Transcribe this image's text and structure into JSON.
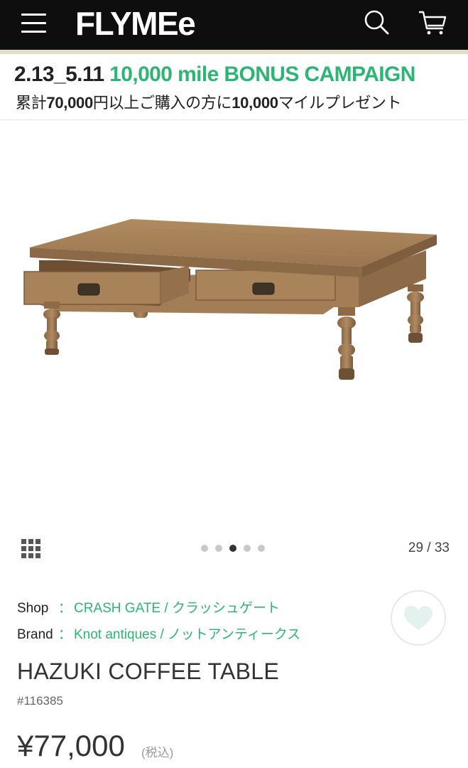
{
  "header": {
    "logo": "FLYMEe",
    "menu_icon": "hamburger-menu-icon",
    "search_icon": "search-icon",
    "cart_icon": "cart-icon",
    "background": "#0e0e0e"
  },
  "banner": {
    "dates": "2.13_5.11",
    "campaign": "10,000 mile BONUS CAMPAIGN",
    "line2_prefix": "累計",
    "line2_amount": "70,000",
    "line2_middle": "円以上ご購入の方に",
    "line2_miles": "10,000",
    "line2_suffix": "マイルプレゼント",
    "accent_color": "#2bb673"
  },
  "gallery": {
    "image": "product-photo-coffee-table",
    "grid_icon": "grid-icon",
    "dots_count": 5,
    "active_dot": 2,
    "counter": "29 / 33"
  },
  "product": {
    "shop_label": "Shop",
    "shop_separator": "：",
    "shop_value": "CRASH GATE / クラッシュゲート",
    "brand_label": "Brand",
    "brand_separator": "：",
    "brand_value": "Knot antiques / ノットアンティークス",
    "title": "HAZUKI COFFEE TABLE",
    "sku": "#116385",
    "price": "¥77,000",
    "tax_note": "(税込)",
    "favorite_icon": "heart-icon"
  }
}
